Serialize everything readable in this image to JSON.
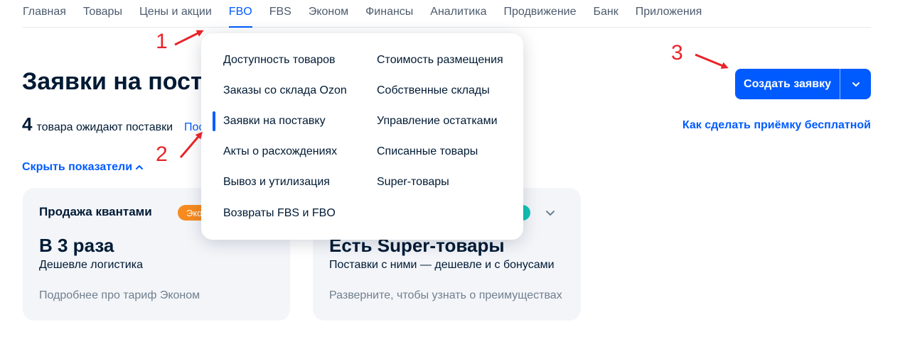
{
  "nav": {
    "items": [
      "Главная",
      "Товары",
      "Цены и акции",
      "FBO",
      "FBS",
      "Эконом",
      "Финансы",
      "Аналитика",
      "Продвижение",
      "Банк",
      "Приложения"
    ],
    "active": "FBO"
  },
  "page": {
    "title": "Заявки на поста",
    "summary_count": "4",
    "summary_text": "товара ожидают поставки",
    "summary_link": "Пос",
    "free_link": "Как сделать приёмку бесплатной",
    "hide_link": "Скрыть показатели"
  },
  "create_button": {
    "label": "Создать заявку"
  },
  "cards": [
    {
      "title": "Продажа квантами",
      "badge": "Эко",
      "big": "В 3 раза",
      "sub": "Дешевле логистика",
      "foot": "Подробнее про тариф Эконом"
    },
    {
      "big": "Есть Super-товары",
      "sub": "Поставки с ними — дешевле и с бонусами",
      "foot": "Разверните, чтобы узнать о преимуществах"
    }
  ],
  "dropdown": {
    "col1": [
      "Доступность товаров",
      "Заказы со склада Ozon",
      "Заявки на поставку",
      "Акты о расхождениях",
      "Вывоз и утилизация",
      "Возвраты FBS и FBO"
    ],
    "col2": [
      "Стоимость размещения",
      "Собственные склады",
      "Управление остатками",
      "Списанные товары",
      "Super-товары"
    ],
    "active": "Заявки на поставку"
  },
  "annotations": [
    "1",
    "2",
    "3"
  ],
  "colors": {
    "accent": "#005bff",
    "annotation": "#e8242a",
    "badge_orange": "#f88b1f",
    "badge_teal": "#10c4b4"
  }
}
